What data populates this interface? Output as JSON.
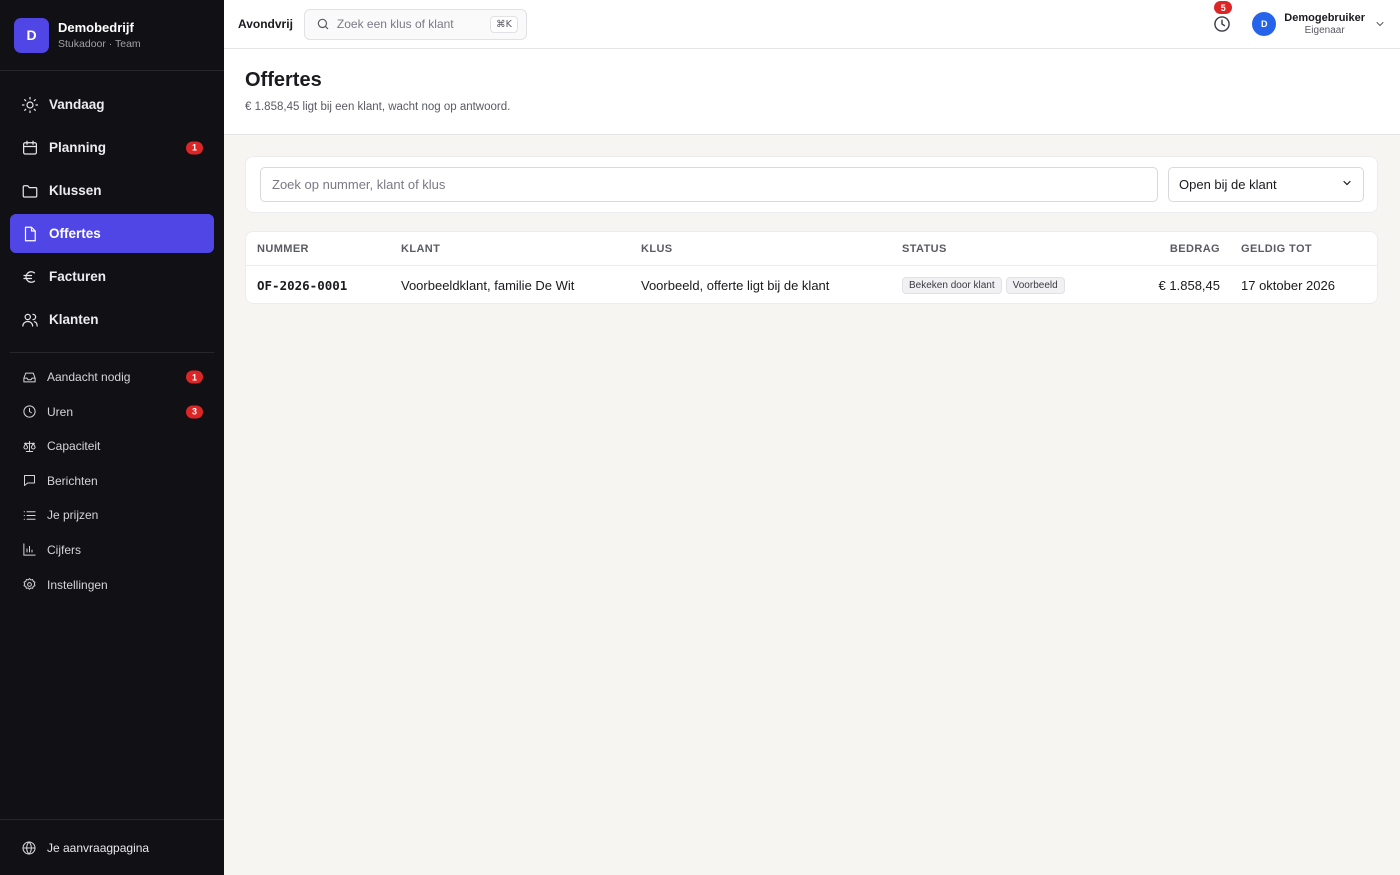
{
  "sidebar": {
    "brand": {
      "initial": "D",
      "name": "Demobedrijf",
      "subtitle": "Stukadoor · Team"
    },
    "main_items": [
      {
        "label": "Vandaag",
        "icon": "sun-icon"
      },
      {
        "label": "Planning",
        "icon": "calendar-icon",
        "badge": "1"
      },
      {
        "label": "Klussen",
        "icon": "folder-icon"
      },
      {
        "label": "Offertes",
        "icon": "document-icon",
        "active": true
      },
      {
        "label": "Facturen",
        "icon": "euro-icon"
      },
      {
        "label": "Klanten",
        "icon": "users-icon"
      }
    ],
    "secondary_items": [
      {
        "label": "Aandacht nodig",
        "icon": "inbox-icon",
        "badge": "1"
      },
      {
        "label": "Uren",
        "icon": "clock-icon",
        "badge": "3"
      },
      {
        "label": "Capaciteit",
        "icon": "scale-icon"
      },
      {
        "label": "Berichten",
        "icon": "message-icon"
      },
      {
        "label": "Je prijzen",
        "icon": "list-icon"
      },
      {
        "label": "Cijfers",
        "icon": "bar-chart-icon"
      },
      {
        "label": "Instellingen",
        "icon": "gear-icon"
      }
    ],
    "footer": {
      "label": "Je aanvraagpagina",
      "icon": "globe-icon"
    }
  },
  "topbar": {
    "workspace": "Avondvrij",
    "search_placeholder": "Zoek een klus of klant",
    "shortcut": "⌘K",
    "clock_badge": "5",
    "user": {
      "initial": "D",
      "name": "Demogebruiker",
      "role": "Eigenaar"
    }
  },
  "page": {
    "title": "Offertes",
    "subtitle": "€ 1.858,45 ligt bij een klant, wacht nog op antwoord."
  },
  "filters": {
    "search_placeholder": "Zoek op nummer, klant of klus",
    "status_selected": "Open bij de klant"
  },
  "table": {
    "headers": {
      "nummer": "NUMMER",
      "klant": "KLANT",
      "klus": "KLUS",
      "status": "STATUS",
      "bedrag": "BEDRAG",
      "geldig": "GELDIG TOT"
    },
    "rows": [
      {
        "nummer": "OF-2026-0001",
        "klant": "Voorbeeldklant, familie De Wit",
        "klus": "Voorbeeld, offerte ligt bij de klant",
        "status_tags": [
          "Bekeken door klant",
          "Voorbeeld"
        ],
        "bedrag": "€ 1.858,45",
        "geldig_tot": "17 oktober 2026"
      }
    ]
  },
  "colors": {
    "accent": "#4f46e5",
    "sidebar_bg": "#111115",
    "badge": "#dc2626",
    "avatar": "#2563eb",
    "page_bg": "#f6f5f1"
  }
}
